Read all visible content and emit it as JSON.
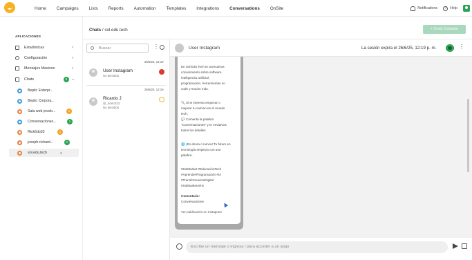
{
  "nav": {
    "items": [
      "Home",
      "Campaigns",
      "Lists",
      "Reports",
      "Automation",
      "Templates",
      "Integrations",
      "Conversations",
      "OnSite"
    ],
    "active": "Conversations",
    "notifications": "Notifications",
    "help": "Help"
  },
  "sidebar": {
    "title": "APLICACIONES",
    "items": [
      {
        "label": "Estadísticas"
      },
      {
        "label": "Configuración"
      },
      {
        "label": "Mensajes Masivos"
      },
      {
        "label": "Chats",
        "badge": "5"
      }
    ],
    "chats": [
      {
        "label": "Beplic Enterpr...",
        "ring": "#3b9be0",
        "count": ""
      },
      {
        "label": "Beplic Corpora...",
        "ring": "#3b9be0",
        "count": ""
      },
      {
        "label": "Sala web prueb...",
        "ring": "#e87d3e",
        "count": "1",
        "count_color": "#f0a524"
      },
      {
        "label": "Conversaciones...",
        "ring": "#3b9be0",
        "count": "1",
        "count_color": "#2aa552"
      },
      {
        "label": "Rick6do33",
        "ring": "#e87d3e",
        "count": "1",
        "count_color": "#f0a524"
      },
      {
        "label": "joseph.richard...",
        "ring": "#e87d3e",
        "count": "1",
        "count_color": "#2aa552"
      },
      {
        "label": "sol.edu.tech",
        "ring": "#e87d3e",
        "count": "1",
        "plain": true
      }
    ]
  },
  "breadcrumb": {
    "section": "Chats",
    "sep": " / ",
    "page": "sol.edu.tech"
  },
  "create_contact": "+ Crear Contacto",
  "list": {
    "search_placeholder": "Buscar",
    "conversations": [
      {
        "date": "26/6/25, 12:19",
        "name": "User Instagram",
        "sub": "No atendido",
        "status_color": "#d93b2f"
      },
      {
        "date": "26/6/25, 12:19",
        "name": "Ricardo J",
        "sub": "@_rickkr333",
        "sub2": "No atendido",
        "status_color": "#f0b93a"
      }
    ]
  },
  "chat": {
    "name": "User Instagram",
    "session": "La sesión expira el 26/6/25, 12:19 p. m.",
    "message_lines": [
      "En Sol Edu Tech te acercamos",
      "conocimiento sobre software,",
      "inteligencia artificial,",
      "programación, herramientas no",
      "code y mucho más.",
      "",
      "🔍 Si te interesa empezar o",
      "mejorar tu camino en el mundo",
      "tech,",
      "💬 Comentá la palabra",
      "\"Conversaciones\" y te enviamos",
      "todos los detalles.",
      "",
      "🌐 ¡Es ahora o nunca! Tu futuro en",
      "tecnología empieza con una",
      "palabra.",
      "",
      "#SolMarket #EducaciónTech",
      "#AprenderProgramación #IA",
      "#TransformaciónDigital",
      "#SolMarketARG"
    ],
    "comment_label": "Comentario:",
    "comment_value": "Conversaciones",
    "view_post": "Ver publicación en Instagram",
    "composer_placeholder": "Escribe un mensaje o ingresa / para acceder a un atajo"
  }
}
